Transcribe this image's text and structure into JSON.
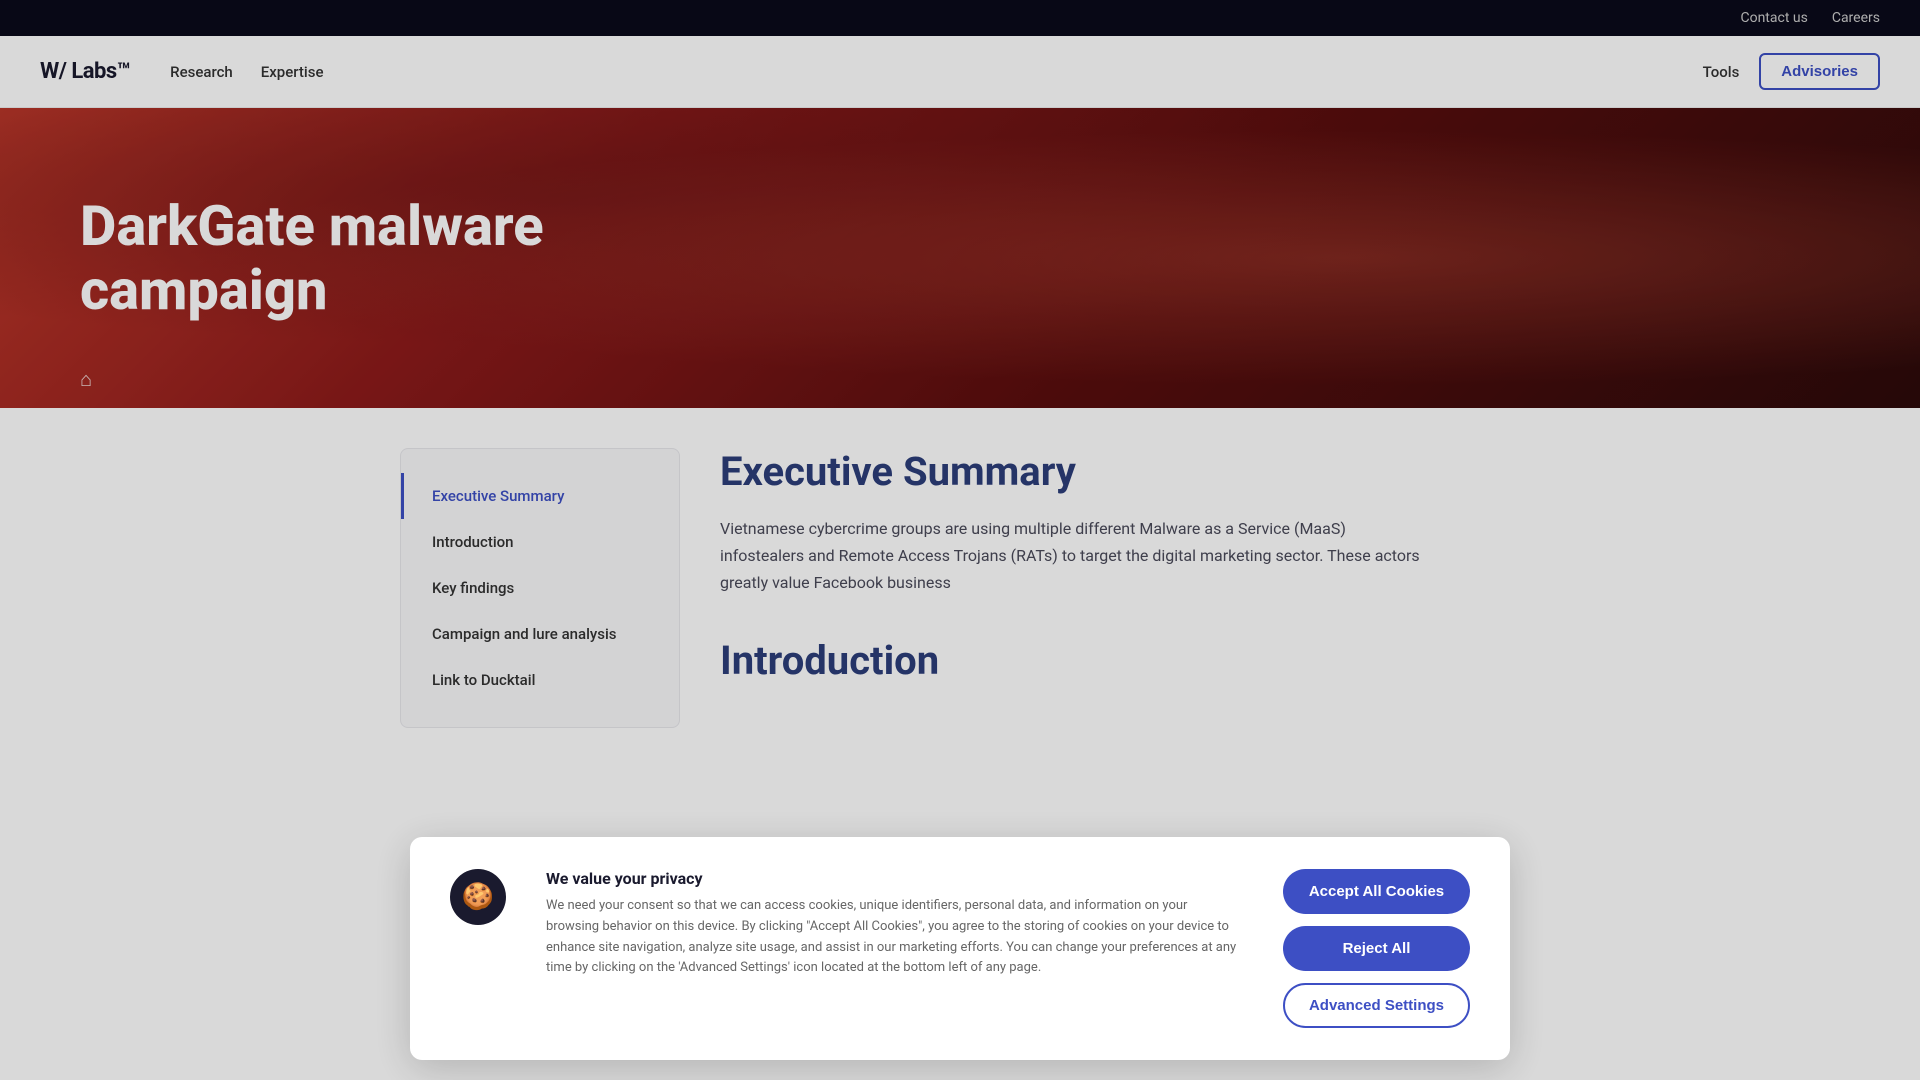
{
  "topbar": {
    "contact": "Contact us",
    "careers": "Careers"
  },
  "nav": {
    "logo": "W/ Labs™",
    "links": [
      "Research",
      "Expertise"
    ],
    "tools": "Tools",
    "advisories": "Advisories"
  },
  "hero": {
    "title": "DarkGate malware campaign",
    "home_icon": "⌂"
  },
  "toc": {
    "items": [
      {
        "label": "Executive Summary",
        "active": true
      },
      {
        "label": "Introduction",
        "active": false
      },
      {
        "label": "Key findings",
        "active": false
      },
      {
        "label": "Campaign and lure analysis",
        "active": false
      },
      {
        "label": "Link to Ducktail",
        "active": false
      }
    ]
  },
  "article": {
    "exec_summary_title": "Executive Summary",
    "exec_summary_text": "Vietnamese cybercrime groups are using multiple different Malware as a Service (MaaS) infostealers and Remote Access Trojans (RATs) to target the digital marketing sector. These actors greatly value Facebook business",
    "intro_title": "Introduction"
  },
  "cookie": {
    "icon": "🍪",
    "title": "We value your privacy",
    "body": "We need your consent so that we can access cookies, unique identifiers, personal data, and information on your browsing behavior on this device. By clicking \"Accept All Cookies\", you agree to the storing of cookies on your device to enhance site navigation, analyze site usage, and assist in our marketing efforts. You can change your preferences at any time by clicking on the 'Advanced Settings' icon located at the bottom left of any page.",
    "accept_label": "Accept All Cookies",
    "reject_label": "Reject All",
    "advanced_label": "Advanced Settings"
  }
}
